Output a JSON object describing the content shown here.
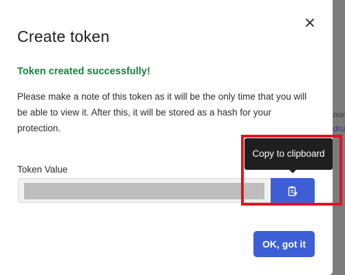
{
  "background": {
    "fragment_1": "min",
    "fragment_2": "dru"
  },
  "modal": {
    "title": "Create token",
    "close_icon": "close-icon",
    "success_message": "Token created successfully!",
    "note": "Please make a note of this token as it will be the only time that you will be able to view it. After this, it will be stored as a hash for your protection.",
    "token_field": {
      "label": "Token Value",
      "value_masked": true
    },
    "copy_button": {
      "icon": "clipboard-icon",
      "tooltip": "Copy to clipboard"
    },
    "ok_button": "OK, got it"
  },
  "colors": {
    "success": "#1a7f3c",
    "primary": "#3d5fd6",
    "highlight": "#e8101f",
    "tooltip_bg": "#1f1f1f"
  }
}
